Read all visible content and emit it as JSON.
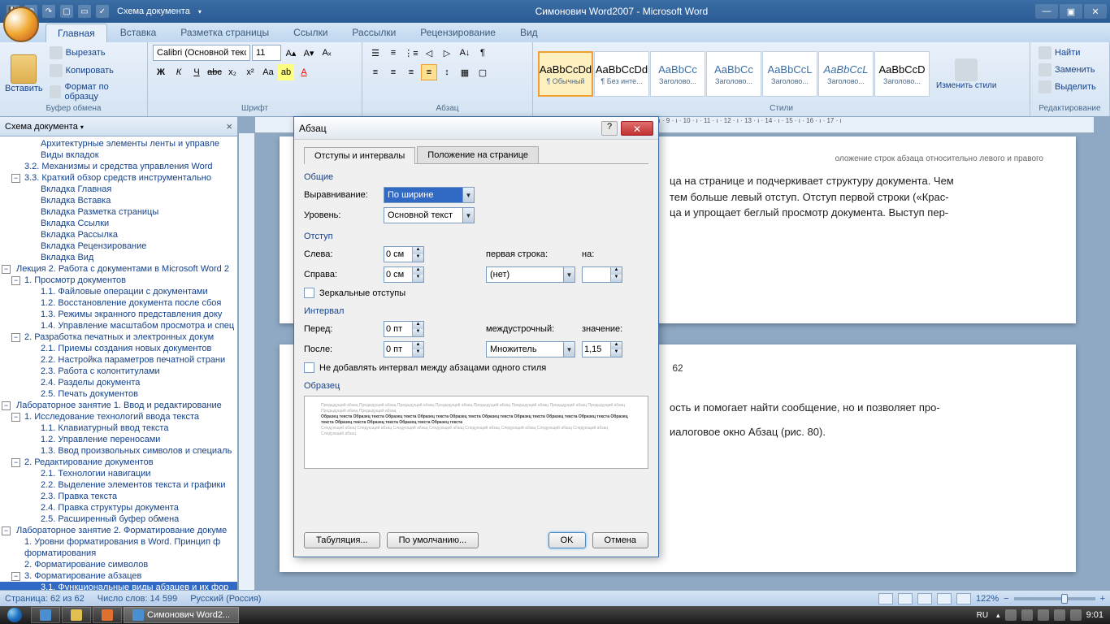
{
  "app": {
    "title": "Симонович Word2007 - Microsoft Word",
    "qat_label": "Схема документа"
  },
  "tabs": [
    "Главная",
    "Вставка",
    "Разметка страницы",
    "Ссылки",
    "Рассылки",
    "Рецензирование",
    "Вид"
  ],
  "ribbon": {
    "clipboard": {
      "paste": "Вставить",
      "cut": "Вырезать",
      "copy": "Копировать",
      "format_painter": "Формат по образцу",
      "label": "Буфер обмена"
    },
    "font": {
      "family": "Calibri (Основной текст)",
      "size": "11",
      "label": "Шрифт"
    },
    "paragraph": {
      "label": "Абзац"
    },
    "styles": {
      "label": "Стили",
      "items": [
        {
          "preview": "AaBbCcDd",
          "name": "¶ Обычный"
        },
        {
          "preview": "AaBbCcDd",
          "name": "¶ Без инте..."
        },
        {
          "preview": "AaBbCc",
          "name": "Заголово..."
        },
        {
          "preview": "AaBbCc",
          "name": "Заголово..."
        },
        {
          "preview": "AaBbCcL",
          "name": "Заголово..."
        },
        {
          "preview": "AaBbCcL",
          "name": "Заголово..."
        },
        {
          "preview": "AaBbCcD",
          "name": "Заголово..."
        }
      ],
      "change": "Изменить стили"
    },
    "editing": {
      "find": "Найти",
      "replace": "Заменить",
      "select": "Выделить",
      "label": "Редактирование"
    }
  },
  "docmap": {
    "title": "Схема документа",
    "items": [
      {
        "lvl": 2,
        "t": "Архитектурные элементы ленты и управле"
      },
      {
        "lvl": 2,
        "t": "Виды вкладок"
      },
      {
        "lvl": 1,
        "t": "3.2. Механизмы и средства управления Word"
      },
      {
        "lvl": 1,
        "t": "3.3. Краткий обзор средств инструментально",
        "exp": true
      },
      {
        "lvl": 2,
        "t": "Вкладка Главная"
      },
      {
        "lvl": 2,
        "t": "Вкладка Вставка"
      },
      {
        "lvl": 2,
        "t": "Вкладка Разметка страницы"
      },
      {
        "lvl": 2,
        "t": "Вкладка Ссылки"
      },
      {
        "lvl": 2,
        "t": "Вкладка Рассылка"
      },
      {
        "lvl": 2,
        "t": "Вкладка Рецензирование"
      },
      {
        "lvl": 2,
        "t": "Вкладка Вид"
      },
      {
        "lvl": 0,
        "t": "Лекция 2. Работа с документами в Microsoft Word 2",
        "exp": true
      },
      {
        "lvl": 1,
        "t": "1. Просмотр документов",
        "exp": true
      },
      {
        "lvl": 2,
        "t": "1.1.  Файловые операции с документами"
      },
      {
        "lvl": 2,
        "t": "1.2.  Восстановление документа после сбоя"
      },
      {
        "lvl": 2,
        "t": "1.3. Режимы экранного  представления доку"
      },
      {
        "lvl": 2,
        "t": "1.4. Управление масштабом просмотра и спец"
      },
      {
        "lvl": 1,
        "t": "2.  Разработка печатных и электронных докум",
        "exp": true
      },
      {
        "lvl": 2,
        "t": "2.1. Приемы создания новых документов"
      },
      {
        "lvl": 2,
        "t": "2.2. Настройка параметров печатной страни"
      },
      {
        "lvl": 2,
        "t": "2.3. Работа с колонтитулами"
      },
      {
        "lvl": 2,
        "t": "2.4. Разделы документа"
      },
      {
        "lvl": 2,
        "t": "2.5. Печать документов"
      },
      {
        "lvl": 0,
        "t": "Лабораторное занятие 1. Ввод и редактирование",
        "exp": true
      },
      {
        "lvl": 1,
        "t": "1. Исследование технологий ввода текста",
        "exp": true
      },
      {
        "lvl": 2,
        "t": "1.1. Клавиатурный ввод текста"
      },
      {
        "lvl": 2,
        "t": "1.2. Управление переносами"
      },
      {
        "lvl": 2,
        "t": "1.3. Ввод произвольных символов и специаль"
      },
      {
        "lvl": 1,
        "t": "2. Редактирование документов",
        "exp": true
      },
      {
        "lvl": 2,
        "t": "2.1. Технологии навигации"
      },
      {
        "lvl": 2,
        "t": "2.2. Выделение элементов текста и графики"
      },
      {
        "lvl": 2,
        "t": "2.3. Правка текста"
      },
      {
        "lvl": 2,
        "t": "2.4. Правка структуры документа"
      },
      {
        "lvl": 2,
        "t": "2.5. Расширенный буфер обмена"
      },
      {
        "lvl": 0,
        "t": "Лабораторное занятие 2. Форматирование докуме",
        "exp": true
      },
      {
        "lvl": 1,
        "t": "1. Уровни форматирования в Word.   Принцип ф"
      },
      {
        "lvl": 1,
        "t": "форматирования"
      },
      {
        "lvl": 1,
        "t": "2. Форматирование символов"
      },
      {
        "lvl": 1,
        "t": "3. Форматирование абзацев",
        "exp": true
      },
      {
        "lvl": 2,
        "t": "3.1. Функциональные виды абзацев и их фор",
        "sel": true
      }
    ]
  },
  "ruler_marks": "· 8 · ı · 9 · ı · 10 · ı · 11 · ı · 12 · ı · 13 · ı · 14 · ı · 15 · ı · 16 · ı · 17 · ı",
  "page1": {
    "frag": "оложение строк абзаца относительно левого и правого",
    "l1": "ца на странице и подчеркивает структуру документа. Чем",
    "l2": "тем больше левый отступ. Отступ первой строки («Крас-",
    "l3": "ца и упрощает беглый просмотр документа. Выступ пер-"
  },
  "page2": {
    "num": "62",
    "l1": "ость  и помогает найти сообщение, но и позволяет про-",
    "l2": "иалоговое окно Абзац (рис. 80)."
  },
  "dialog": {
    "title": "Абзац",
    "tab1": "Отступы и интервалы",
    "tab2": "Положение на странице",
    "general": "Общие",
    "alignment_label": "Выравнивание:",
    "alignment_value": "По ширине",
    "level_label": "Уровень:",
    "level_value": "Основной текст",
    "indent": "Отступ",
    "left_label": "Слева:",
    "left_value": "0 см",
    "right_label": "Справа:",
    "right_value": "0 см",
    "firstline_label": "первая строка:",
    "firstline_value": "(нет)",
    "by_label": "на:",
    "by_value": "",
    "mirror": "Зеркальные отступы",
    "spacing": "Интервал",
    "before_label": "Перед:",
    "before_value": "0 пт",
    "after_label": "После:",
    "after_value": "0 пт",
    "linespacing_label": "междустрочный:",
    "linespacing_value": "Множитель",
    "at_label": "значение:",
    "at_value": "1,15",
    "noadd": "Не добавлять интервал между абзацами одного стиля",
    "preview": "Образец",
    "preview_prev": "Предыдущий абзац Предыдущий абзац Предыдущий абзац Предыдущий абзац Предыдущий абзац Предыдущий абзац Предыдущий абзац Предыдущий абзац Предыдущий абзац Предыдущий абзац",
    "preview_curr": "Образец текста Образец текста Образец текста Образец текста Образец текста Образец текста Образец текста Образец текста Образец текста Образец текста Образец текста Образец текста Образец текста Образец текста",
    "preview_next": "Следующий абзац Следующий абзац Следующий абзац Следующий абзац Следующий абзац Следующий абзац Следующий абзац Следующий абзац Следующий абзац",
    "tabs_btn": "Табуляция...",
    "default_btn": "По умолчанию...",
    "ok": "OK",
    "cancel": "Отмена"
  },
  "status": {
    "page": "Страница: 62 из 62",
    "words": "Число слов: 14 599",
    "lang": "Русский (Россия)",
    "zoom": "122%"
  },
  "taskbar": {
    "app": "Симонович Word2...",
    "lang": "RU",
    "time": "9:01"
  }
}
